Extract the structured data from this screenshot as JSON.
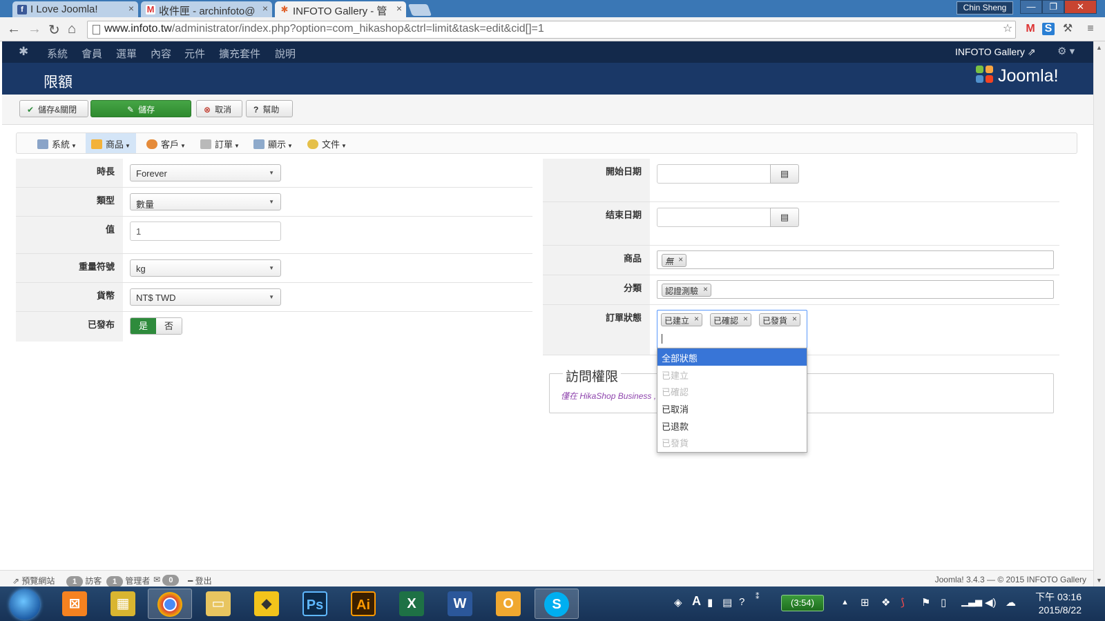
{
  "browser": {
    "tabs": [
      {
        "title": "I Love Joomla!",
        "favicon": "facebook-icon"
      },
      {
        "title": "收件匣 - archinfoto@",
        "favicon": "gmail-icon"
      },
      {
        "title": "INFOTO Gallery - 管",
        "favicon": "joomla-icon",
        "active": true
      }
    ],
    "user": "Chin Sheng",
    "url_host": "www.infoto.tw",
    "url_path": "/administrator/index.php?option=com_hikashop&ctrl=limit&task=edit&cid[]=1"
  },
  "joomla": {
    "menu": [
      "系統",
      "會員",
      "選單",
      "內容",
      "元件",
      "擴充套件",
      "說明"
    ],
    "site_name": "INFOTO Gallery",
    "page_title": "限額",
    "logo_text": "Joomla!"
  },
  "toolbar": {
    "save_close": "儲存&關閉",
    "save": "儲存",
    "cancel": "取消",
    "help": "幫助"
  },
  "submenu": [
    "系統",
    "商品",
    "客戶",
    "訂單",
    "顯示",
    "文件"
  ],
  "form_left": {
    "period_label": "時長",
    "period_value": "Forever",
    "type_label": "類型",
    "type_value": "數量",
    "value_label": "值",
    "value_value": "1",
    "weight_label": "重量符號",
    "weight_value": "kg",
    "currency_label": "貨幣",
    "currency_value": "NT$ TWD",
    "published_label": "已發布",
    "published_yes": "是",
    "published_no": "否"
  },
  "form_right": {
    "start_label": "開始日期",
    "end_label": "结束日期",
    "product_label": "商品",
    "product_tag": "無",
    "category_label": "分類",
    "category_tag": "認證測驗",
    "status_label": "訂單狀態",
    "status_tags": [
      "已建立",
      "已確認",
      "已發貨"
    ]
  },
  "dropdown": [
    {
      "label": "全部狀態",
      "state": "highlighted"
    },
    {
      "label": "已建立",
      "state": "disabled"
    },
    {
      "label": "已確認",
      "state": "disabled"
    },
    {
      "label": "已取消",
      "state": "normal"
    },
    {
      "label": "已退款",
      "state": "normal"
    },
    {
      "label": "已發貨",
      "state": "disabled"
    }
  ],
  "access": {
    "legend": "訪問權限",
    "note": "僅在 HikaShop Business ,"
  },
  "footer": {
    "preview": "預覽網站",
    "visitors_count": "1",
    "visitors_label": "訪客",
    "admins_count": "1",
    "admins_label": "管理者",
    "messages_count": "0",
    "logout": "登出",
    "copyright": "Joomla! 3.4.3 — © 2015 INFOTO Gallery"
  },
  "taskbar": {
    "battery": "(3:54)",
    "clock_ampm_time": "下午 03:16",
    "clock_date": "2015/8/22"
  },
  "colors": {
    "joomla_topbar": "#13294b",
    "joomla_header": "#1a3867",
    "save_green": "#46a546",
    "dropdown_highlight": "#3875d7"
  }
}
